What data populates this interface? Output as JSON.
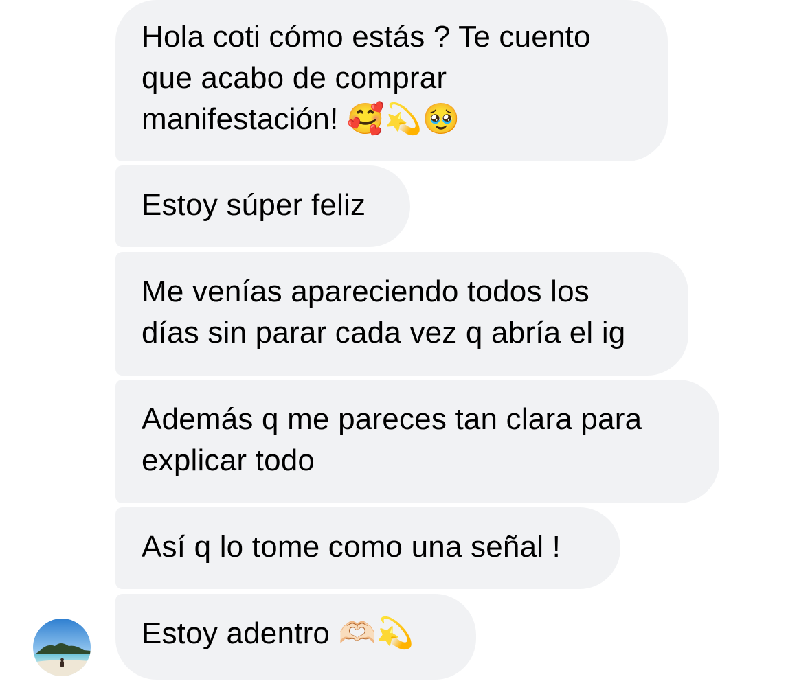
{
  "conversation": {
    "messages": [
      {
        "text": "Hola coti cómo estás ? Te cuento\nque acabo de comprar\nmanifestación! 🥰💫🥹"
      },
      {
        "text": "Estoy súper feliz"
      },
      {
        "text": "Me venías apareciendo todos los\ndías sin parar cada vez q abría el ig"
      },
      {
        "text": "Además q me pareces tan clara para\nexplicar todo"
      },
      {
        "text": "Así q lo tome como una señal !"
      },
      {
        "text": "Estoy adentro 🫶🏻💫"
      }
    ],
    "sender_avatar": {
      "icon": "beach-photo-avatar"
    }
  },
  "colors": {
    "bubble_background": "#f1f2f4",
    "text": "#000000",
    "page_background": "#ffffff"
  }
}
